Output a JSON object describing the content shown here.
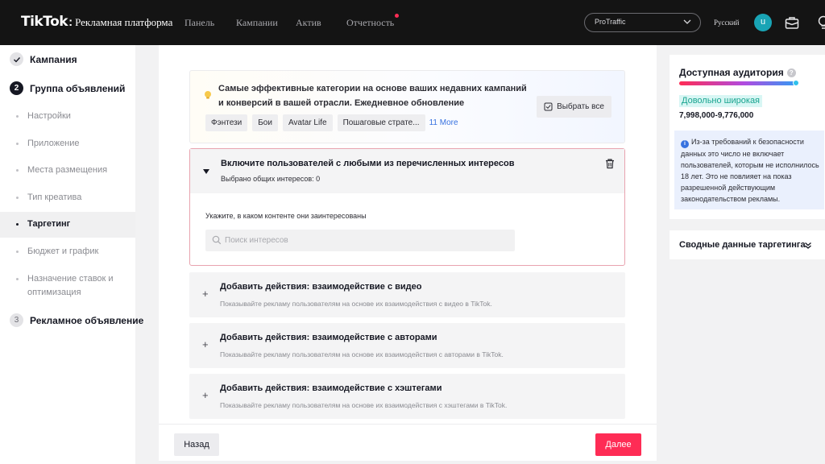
{
  "brand": {
    "logo": "TikTok",
    "colon": ":",
    "subtitle": "Рекламная платформа"
  },
  "nav": [
    {
      "label": "Панель"
    },
    {
      "label": "Кампании"
    },
    {
      "label": "Актив"
    },
    {
      "label": "Отчетность",
      "has_notification_dot": true
    }
  ],
  "header": {
    "account": "ProTraffic",
    "language": "Русский",
    "avatar_letter": "u",
    "icons": [
      "briefcase-icon",
      "lightbulb-icon"
    ]
  },
  "sidebar": {
    "steps": [
      {
        "number": "✓",
        "label": "Кампания",
        "state": "done"
      },
      {
        "number": "2",
        "label": "Группа объявлений",
        "state": "active"
      },
      {
        "number": "3",
        "label": "Рекламное объявление",
        "state": "future"
      }
    ],
    "subitems": [
      "Настройки",
      "Приложение",
      "Места размещения",
      "Тип креатива",
      "Таргетинг",
      "Бюджет и график",
      "Назначение ставок и оптимизация"
    ],
    "active_subitem": "Таргетинг"
  },
  "suggestions": {
    "text": "Самые эффективные категории на основе ваших недавних кампаний и конверсий в вашей отрасли. Ежедневное обновление",
    "chips": [
      "Фэнтези",
      "Бои",
      "Avatar Life",
      "Пошаговые страте..."
    ],
    "more": "11 More",
    "select_all": "Выбрать все"
  },
  "interests": {
    "title": "Включите пользователей с любыми из перечисленных интересов",
    "count": "Выбрано общих интересов: 0",
    "hint": "Укажите, в каком контенте они заинтересованы",
    "search_placeholder": "Поиск интересов"
  },
  "actions": [
    {
      "title": "Добавить действия: взаимодействие с видео",
      "desc": "Показывайте рекламу пользователям на основе их взаимодействия с видео в TikTok."
    },
    {
      "title": "Добавить действия: взаимодействие с авторами",
      "desc": "Показывайте рекламу пользователям на основе их взаимодействия с авторами в TikTok."
    },
    {
      "title": "Добавить действия: взаимодействие с хэштегами",
      "desc": "Показывайте рекламу пользователям на основе их взаимодействия с хэштегами в TikTok."
    }
  ],
  "footer": {
    "back": "Назад",
    "next": "Далее"
  },
  "audience": {
    "title": "Доступная аудитория",
    "status": "Довольно широкая",
    "range": "7,998,000-9,776,000",
    "note": "Из-за требований к безопасности данных это число не включает пользователей, которым не исполнилось 18 лет. Это не повлияет на показ разрешенной действующим законодательством рекламы."
  },
  "summary": {
    "title": "Сводные данные таргетинга"
  },
  "colors": {
    "accent": "#fe2c55",
    "topbar": "#141414",
    "status_text": "#18a48f",
    "link": "#3772e0"
  }
}
